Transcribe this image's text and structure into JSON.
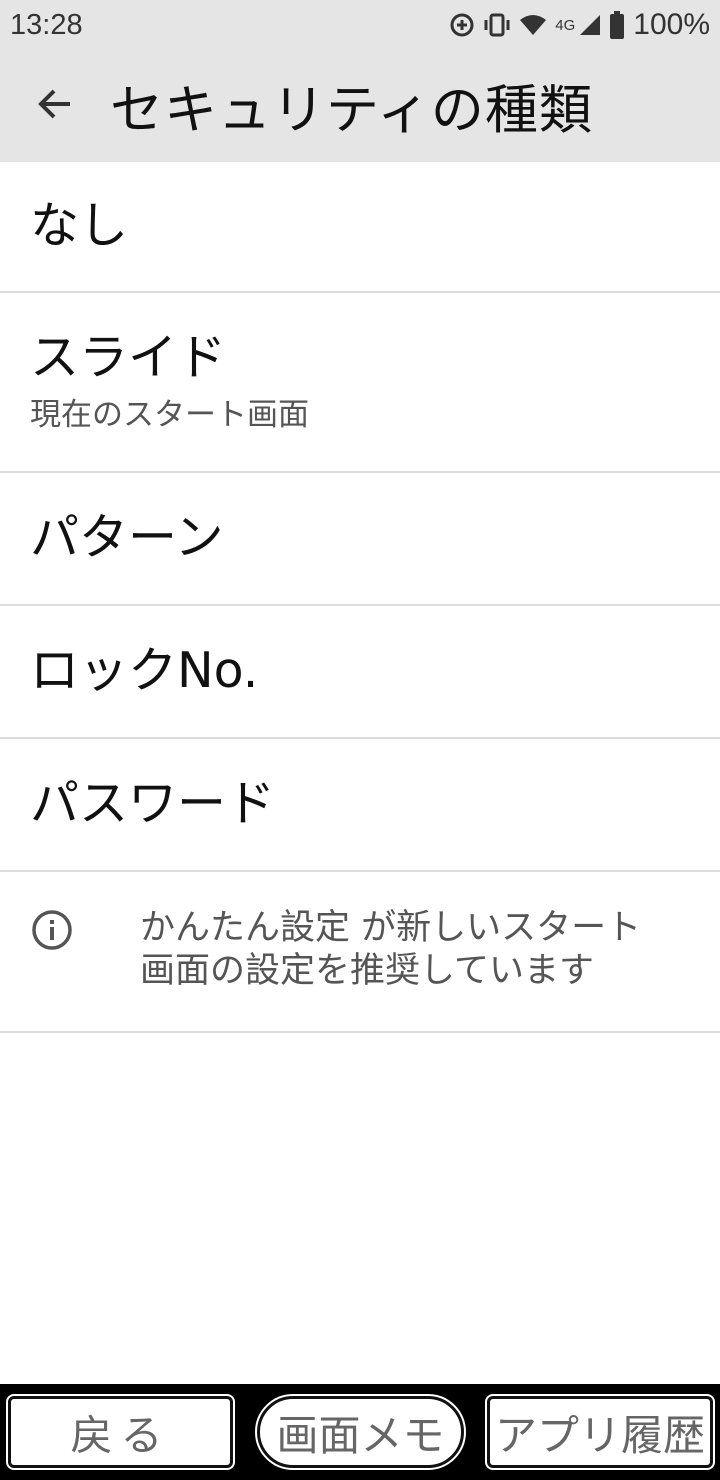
{
  "status_bar": {
    "time": "13:28",
    "network": "4G",
    "battery": "100%",
    "icons": [
      "data-saver-icon",
      "vibrate-icon",
      "wifi-icon",
      "cell-signal-icon",
      "battery-icon"
    ]
  },
  "app_bar": {
    "title": "セキュリティの種類",
    "back_icon": "arrow-left-icon"
  },
  "options": [
    {
      "label": "なし"
    },
    {
      "label": "スライド",
      "sublabel": "現在のスタート画面"
    },
    {
      "label": "パターン"
    },
    {
      "label": "ロックNo."
    },
    {
      "label": "パスワード"
    }
  ],
  "info": {
    "icon": "info-icon",
    "text_line1": "かんたん設定 が新しいスタート",
    "text_line2": "画面の設定を推奨しています"
  },
  "nav_bar": {
    "back_label": "戻る",
    "memo_label": "画面メモ",
    "history_label": "アプリ履歴"
  }
}
